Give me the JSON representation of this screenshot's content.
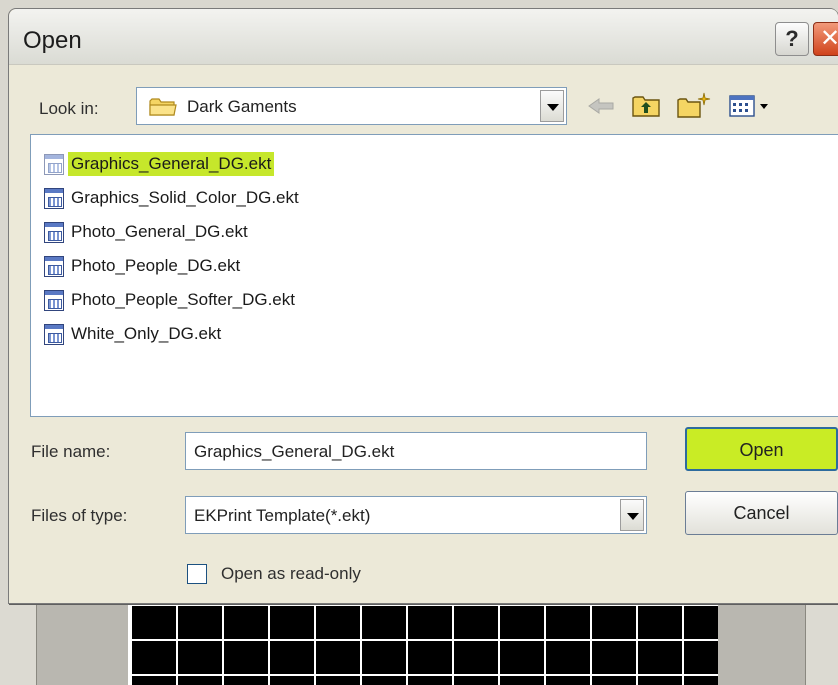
{
  "dialog": {
    "title": "Open",
    "help_symbol": "?",
    "close_symbol": "✕"
  },
  "look_in": {
    "label": "Look in:",
    "value": "Dark Gaments",
    "icon": "folder-icon"
  },
  "toolbar": {
    "buttons": [
      "back-arrow-icon",
      "up-folder-icon",
      "new-folder-icon",
      "views-menu-icon"
    ]
  },
  "files": [
    {
      "name": "Graphics_General_DG.ekt",
      "selected": true
    },
    {
      "name": "Graphics_Solid_Color_DG.ekt",
      "selected": false
    },
    {
      "name": "Photo_General_DG.ekt",
      "selected": false
    },
    {
      "name": "Photo_People_DG.ekt",
      "selected": false
    },
    {
      "name": "Photo_People_Softer_DG.ekt",
      "selected": false
    },
    {
      "name": "White_Only_DG.ekt",
      "selected": false
    }
  ],
  "file_name": {
    "label": "File name:",
    "value": "Graphics_General_DG.ekt"
  },
  "file_type": {
    "label": "Files of type:",
    "value": "EKPrint Template(*.ekt)"
  },
  "buttons": {
    "open": "Open",
    "cancel": "Cancel"
  },
  "readonly": {
    "label": "Open as read-only",
    "checked": false
  },
  "colors": {
    "highlight": "#c6e72b",
    "open_button": "#c9ec25"
  }
}
